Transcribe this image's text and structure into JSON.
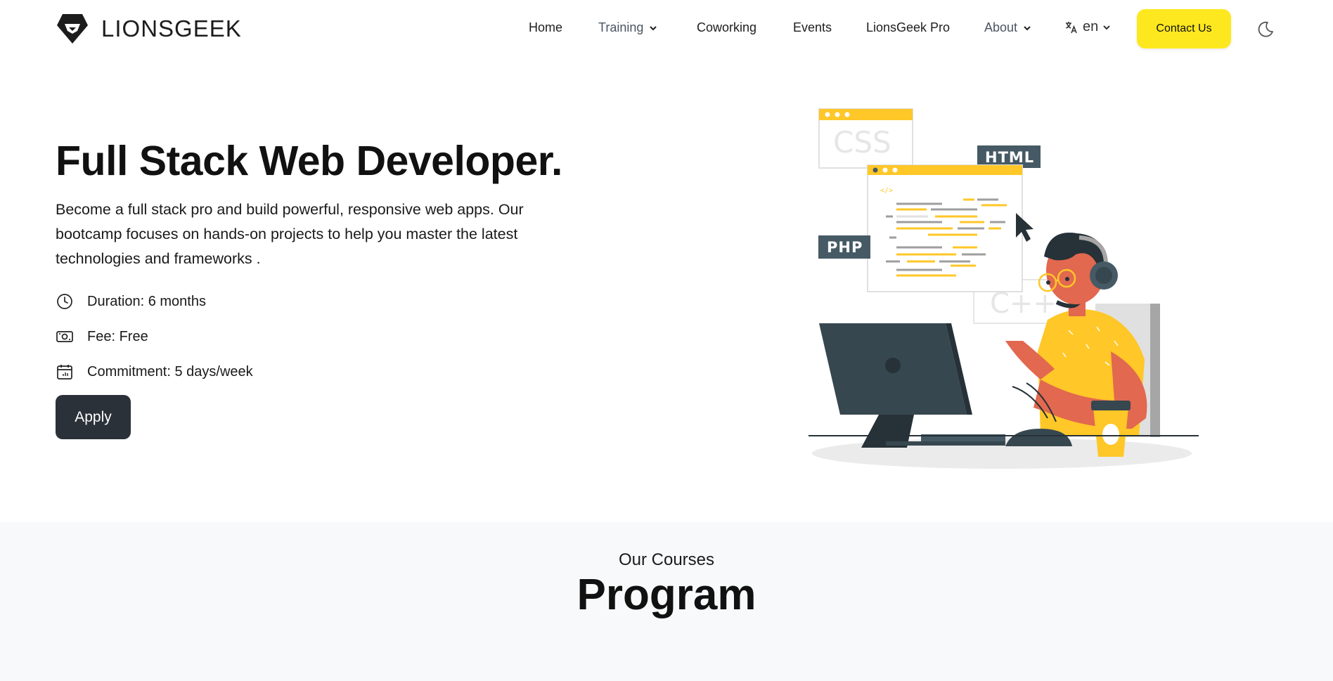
{
  "brand": {
    "name": "LIONSGEEK"
  },
  "nav": {
    "home": "Home",
    "training": "Training",
    "coworking": "Coworking",
    "events": "Events",
    "pro": "LionsGeek Pro",
    "about": "About",
    "language": "en",
    "contact": "Contact Us"
  },
  "hero": {
    "title": "Full Stack Web Developer.",
    "description": "Become a full stack pro and build powerful, responsive web apps. Our bootcamp focuses on hands-on projects to help you master the latest technologies and frameworks .",
    "facts": [
      {
        "icon": "clock-icon",
        "text": "Duration: 6 months"
      },
      {
        "icon": "money-icon",
        "text": "Fee: Free"
      },
      {
        "icon": "calendar-icon",
        "text": "Commitment: 5 days/week"
      }
    ],
    "apply": "Apply"
  },
  "illustration": {
    "labels": {
      "css": "CSS",
      "html": "HTML",
      "php": "PHP",
      "cpp": "C++"
    }
  },
  "program": {
    "eyebrow": "Our Courses",
    "title": "Program"
  },
  "colors": {
    "accent": "#fde81f",
    "dark": "#2b3138",
    "illus_yellow": "#ffc727",
    "illus_skin": "#e2684f",
    "illus_slate": "#37474f"
  }
}
